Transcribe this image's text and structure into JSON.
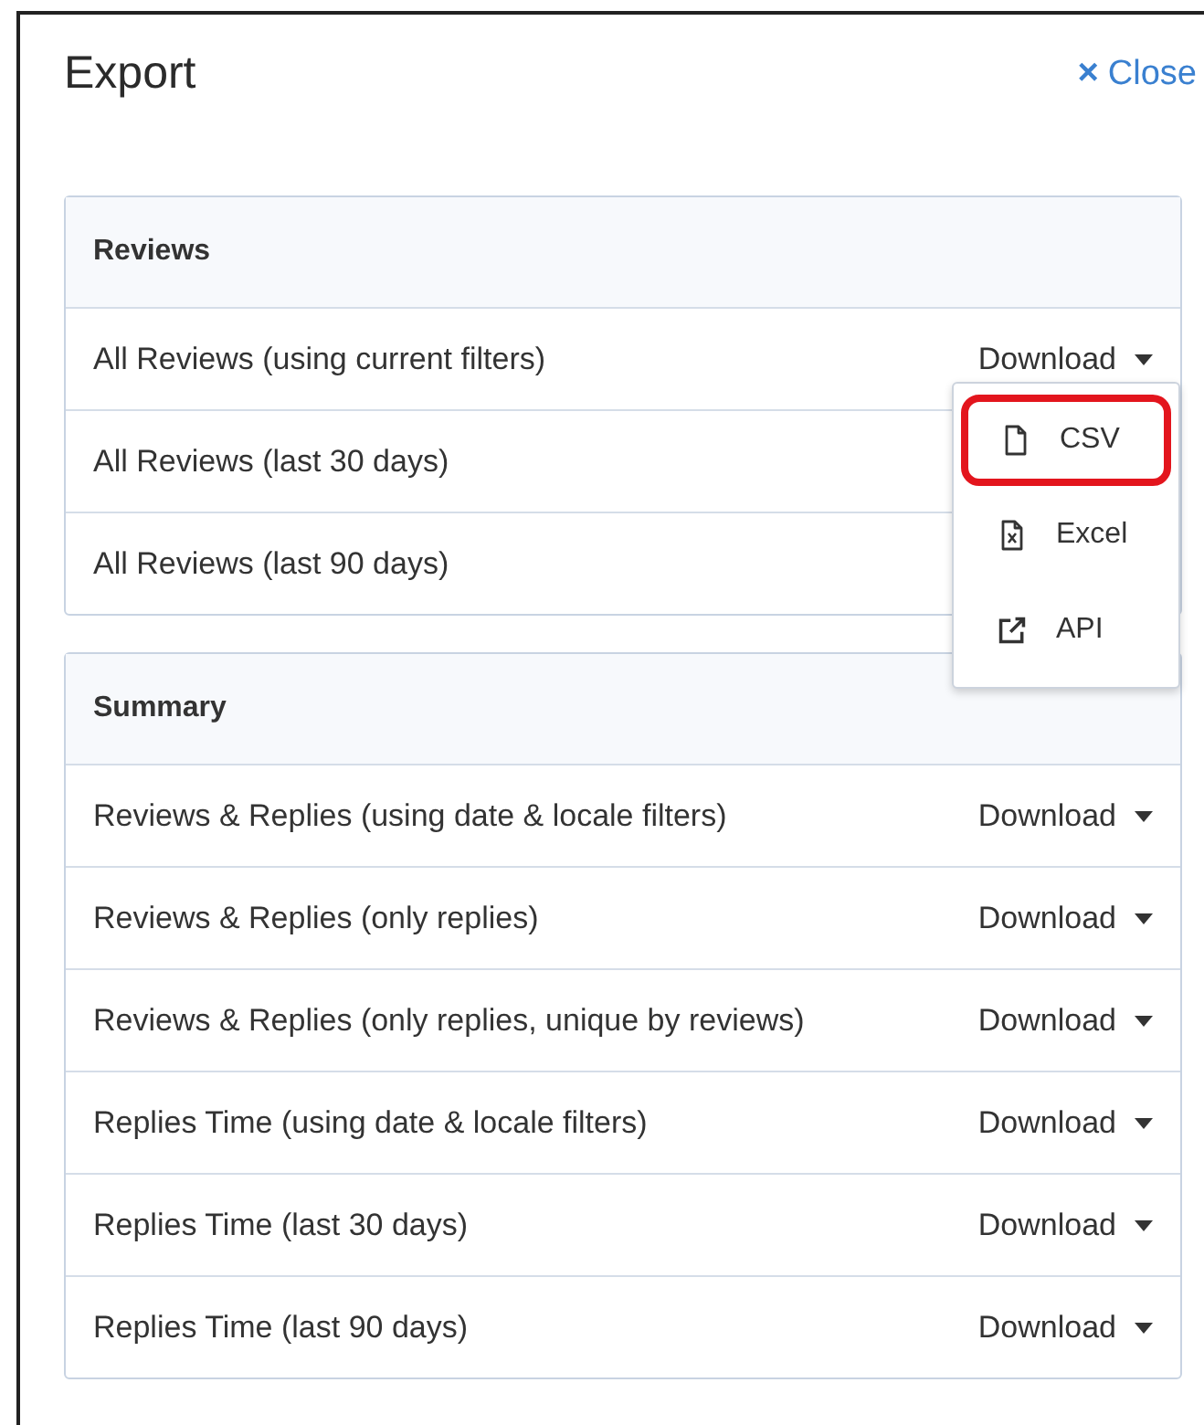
{
  "dialog": {
    "title": "Export",
    "close": {
      "icon": "×",
      "label": "Close"
    }
  },
  "sections": [
    {
      "title": "Reviews",
      "rows": [
        {
          "label": "All Reviews (using current filters)",
          "download": "Download",
          "menu": [
            {
              "kind": "file",
              "label": "CSV",
              "highlighted": true
            },
            {
              "kind": "excel",
              "label": "Excel",
              "highlighted": false
            },
            {
              "kind": "external",
              "label": "API",
              "highlighted": false
            }
          ]
        },
        {
          "label": "All Reviews (last 30 days)"
        },
        {
          "label": "All Reviews (last 90 days)"
        }
      ]
    },
    {
      "title": "Summary",
      "rows": [
        {
          "label": "Reviews & Replies (using date & locale filters)",
          "download": "Download"
        },
        {
          "label": "Reviews & Replies (only replies)",
          "download": "Download"
        },
        {
          "label": "Reviews & Replies (only replies, unique by reviews)",
          "download": "Download"
        },
        {
          "label": "Replies Time (using date & locale filters)",
          "download": "Download"
        },
        {
          "label": "Replies Time (last 30 days)",
          "download": "Download"
        },
        {
          "label": "Replies Time (last 90 days)",
          "download": "Download"
        }
      ]
    }
  ]
}
